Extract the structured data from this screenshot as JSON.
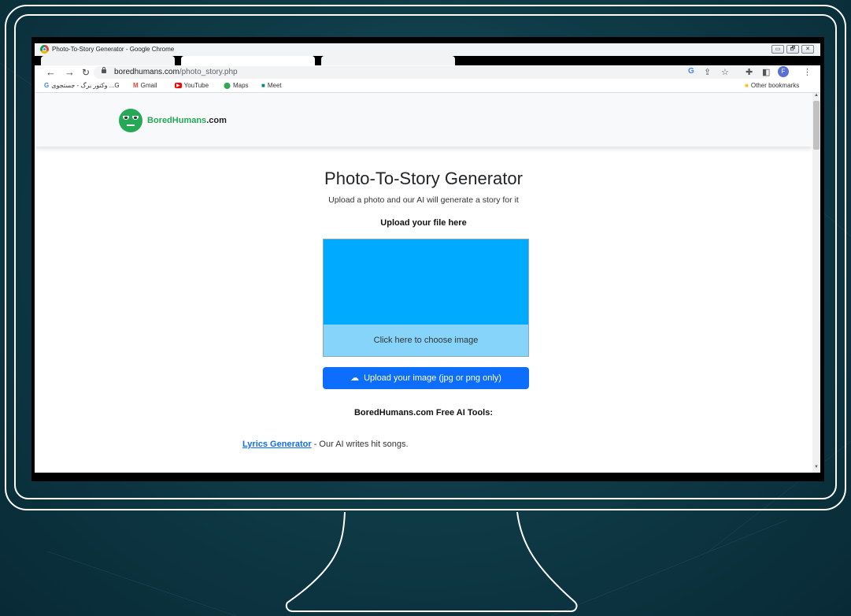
{
  "window": {
    "title": "Photo-To-Story Generator - Google Chrome",
    "controls": [
      "▭",
      "🗗",
      "✕"
    ]
  },
  "toolbar": {
    "url_host": "boredhumans.com",
    "url_path": "/photo_story.php",
    "avatar_letter": "F"
  },
  "bookmarks": {
    "items": [
      {
        "label": "وکتور برگ - جستجوی ...G",
        "icon": "google-icon"
      },
      {
        "label": "Gmail",
        "icon": "gmail-icon"
      },
      {
        "label": "YouTube",
        "icon": "youtube-icon"
      },
      {
        "label": "Maps",
        "icon": "maps-icon"
      },
      {
        "label": "Meet",
        "icon": "meet-icon"
      }
    ],
    "other": "Other bookmarks"
  },
  "site": {
    "logo_main": "BoredHumans",
    "logo_suffix": ".com"
  },
  "main": {
    "title": "Photo-To-Story Generator",
    "subtitle": "Upload a photo and our AI will generate a story for it",
    "upload_label": "Upload your file here",
    "choose_image": "Click here to choose image",
    "upload_button": "Upload your image (jpg or png only)",
    "tools_title": "BoredHumans.com Free AI Tools:",
    "tools": [
      {
        "name": "Lyrics Generator",
        "desc": " - Our AI writes hit songs."
      }
    ]
  },
  "colors": {
    "drop_zone": "#00aaff",
    "drop_zone_caption_bg": "#87d4fa",
    "button_primary": "#0d6efd",
    "logo_green": "#26a957"
  }
}
